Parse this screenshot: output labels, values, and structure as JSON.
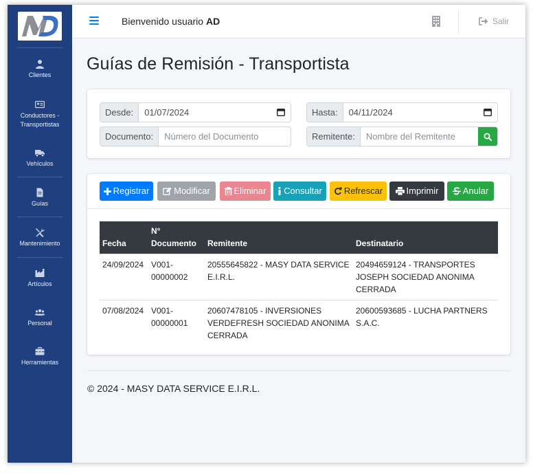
{
  "topbar": {
    "welcome_prefix": "Bienvenido usuario",
    "user": "AD",
    "logout_label": "Salir"
  },
  "sidebar": {
    "items": [
      {
        "label": "Clientes",
        "icon": "user-icon"
      },
      {
        "label": "Conductores -",
        "label2": "Transportistas",
        "icon": "id-card-icon"
      },
      {
        "label": "Vehículos",
        "icon": "truck-icon"
      },
      {
        "label": "Guías",
        "icon": "file-icon"
      },
      {
        "label": "Mantenimiento",
        "icon": "tools-icon"
      },
      {
        "label": "Artículos",
        "icon": "industry-icon"
      },
      {
        "label": "Personal",
        "icon": "users-icon"
      },
      {
        "label": "Herramientas",
        "icon": "toolbox-icon"
      }
    ]
  },
  "page": {
    "title": "Guías de Remisión - Transportista"
  },
  "filters": {
    "desde_label": "Desde:",
    "desde_value": "01/07/2024",
    "hasta_label": "Hasta:",
    "hasta_value": "04/11/2024",
    "documento_label": "Documento:",
    "documento_placeholder": "Número del Documento",
    "remitente_label": "Remitente:",
    "remitente_placeholder": "Nombre del Remitente"
  },
  "toolbar": {
    "registrar": "Registrar",
    "modificar": "Modificar",
    "eliminar": "Eliminar",
    "consultar": "Consultar",
    "refrescar": "Refrescar",
    "imprimir": "Imprimir",
    "anular": "Anular"
  },
  "table": {
    "headers": {
      "fecha": "Fecha",
      "doc1": "N°",
      "doc2": "Documento",
      "remitente": "Remitente",
      "destinatario": "Destinatario"
    },
    "rows": [
      {
        "fecha": "24/09/2024",
        "doc_a": "V001-",
        "doc_b": "00000002",
        "rem_a": "20555645822 - MASY DATA SERVICE",
        "rem_b": "E.I.R.L.",
        "rem_c": "",
        "dest_a": "20494659124 - TRANSPORTES",
        "dest_b": "JOSEPH SOCIEDAD ANONIMA",
        "dest_c": "CERRADA"
      },
      {
        "fecha": "07/08/2024",
        "doc_a": "V001-",
        "doc_b": "00000001",
        "rem_a": "20607478105 - INVERSIONES",
        "rem_b": "VERDEFRESH SOCIEDAD ANONIMA",
        "rem_c": "CERRADA",
        "dest_a": "20600593685 - LUCHA PARTNERS",
        "dest_b": "S.A.C.",
        "dest_c": ""
      }
    ]
  },
  "footer": {
    "text": "© 2024 - MASY DATA SERVICE E.I.R.L."
  },
  "colors": {
    "sidebar": "#1f3f7e",
    "primary": "#007bff",
    "success": "#28a745",
    "warning": "#ffc107",
    "info": "#17a2b8",
    "danger_faded": "#e9868f",
    "secondary_faded": "#9ea4a9",
    "dark": "#343a40"
  }
}
